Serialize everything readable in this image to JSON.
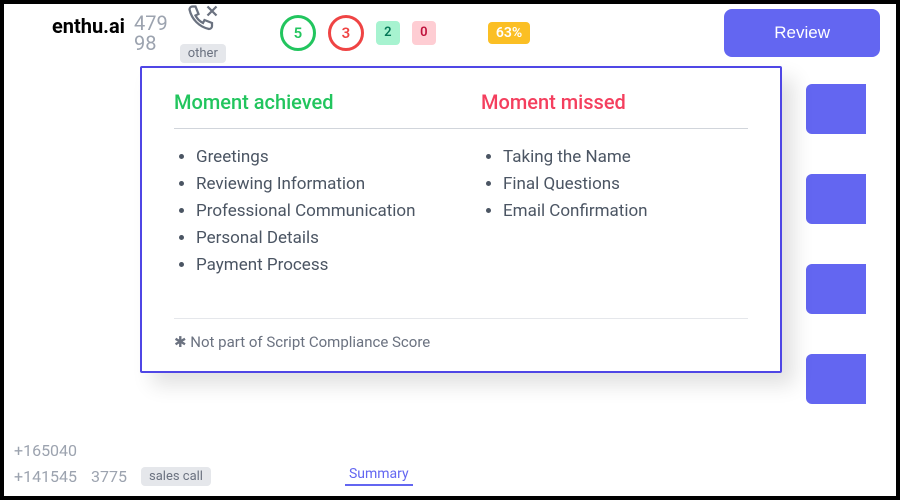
{
  "logo": "enthu.ai",
  "topbar": {
    "num1": "479",
    "num2": "98",
    "phone_label": "other",
    "green_count": "5",
    "red_count": "3",
    "teal_count": "2",
    "pink_count": "0",
    "percent": "63%",
    "review_label": "Review"
  },
  "modal": {
    "achieved_header": "Moment achieved",
    "missed_header": "Moment missed",
    "achieved_items": [
      "Greetings",
      "Reviewing Information",
      "Professional Communication",
      "Personal Details",
      "Payment Process"
    ],
    "missed_items": [
      "Taking the Name",
      "Final Questions",
      "Email Confirmation"
    ],
    "footnote": "Not part of Script Compliance Score"
  },
  "bottom": {
    "row1": "+165040",
    "row2_num": "+141545",
    "row2_extra": "3775",
    "tag": "sales call",
    "summary": "Summary"
  }
}
